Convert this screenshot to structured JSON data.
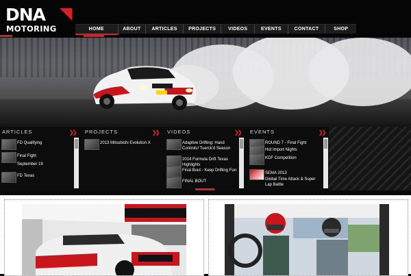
{
  "logo": {
    "top": "DNA",
    "bottom": "MOTORING"
  },
  "nav": {
    "items": [
      "HOME",
      "ABOUT",
      "ARTICLES",
      "PROJECTS",
      "VIDEOS",
      "EVENTS",
      "CONTACT",
      "SHOP"
    ],
    "active": "HOME"
  },
  "sections": {
    "articles": {
      "title": "ARTICLES",
      "items": [
        "FD Qualifying",
        "Final Fight",
        "September 19",
        "FD Texas"
      ]
    },
    "projects": {
      "title": "PROJECTS",
      "items": [
        "2013 Mitsubishi Evolution X"
      ]
    },
    "videos": {
      "title": "VIDEOS",
      "items": [
        "Adaptive Drifting: Hand Controls! Tuerck'd Season",
        "2014 Formula Drift Texas Highlights",
        "Final Bout - Keep Drifting Fun",
        "FINAL BOUT"
      ]
    },
    "events": {
      "title": "EVENTS",
      "items": [
        "ROUND 7 - Final Fight",
        "Hot Import Nights",
        "KDF Competition",
        "SEMA 2013",
        "Global Time Attack & Super Lap Battle"
      ]
    }
  },
  "colors": {
    "accent": "#d62027",
    "background": "#0a0a0a",
    "nav": "#1c1c1c"
  }
}
